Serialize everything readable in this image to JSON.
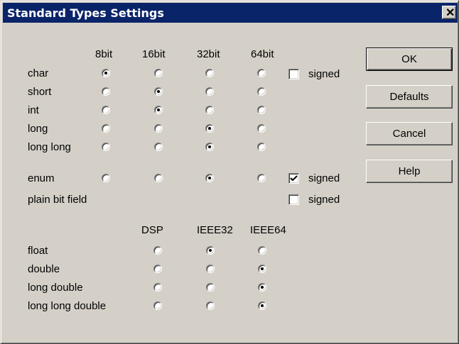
{
  "window": {
    "title": "Standard Types Settings",
    "close_glyph": "✕"
  },
  "int_section": {
    "columns": [
      "8bit",
      "16bit",
      "32bit",
      "64bit"
    ],
    "rows": [
      {
        "label": "char",
        "selected": 0
      },
      {
        "label": "short",
        "selected": 1
      },
      {
        "label": "int",
        "selected": 1
      },
      {
        "label": "long",
        "selected": 2
      },
      {
        "label": "long long",
        "selected": 2
      },
      {
        "label": "enum",
        "selected": 2
      }
    ],
    "plain_bit_field_label": "plain bit field"
  },
  "signed": {
    "char": {
      "label": "signed",
      "checked": false
    },
    "enum": {
      "label": "signed",
      "checked": true
    },
    "plain_bit_field": {
      "label": "signed",
      "checked": false
    }
  },
  "float_section": {
    "columns": [
      "DSP",
      "IEEE32",
      "IEEE64"
    ],
    "rows": [
      {
        "label": "float",
        "selected": 1
      },
      {
        "label": "double",
        "selected": 2
      },
      {
        "label": "long double",
        "selected": 2
      },
      {
        "label": "long long double",
        "selected": 2
      }
    ]
  },
  "buttons": {
    "ok": "OK",
    "defaults": "Defaults",
    "cancel": "Cancel",
    "help": "Help"
  },
  "colors": {
    "face": "#d4d0c8",
    "title_bar": "#0a246a"
  },
  "icons": {
    "close": "close-icon",
    "check": "checkmark-icon"
  }
}
